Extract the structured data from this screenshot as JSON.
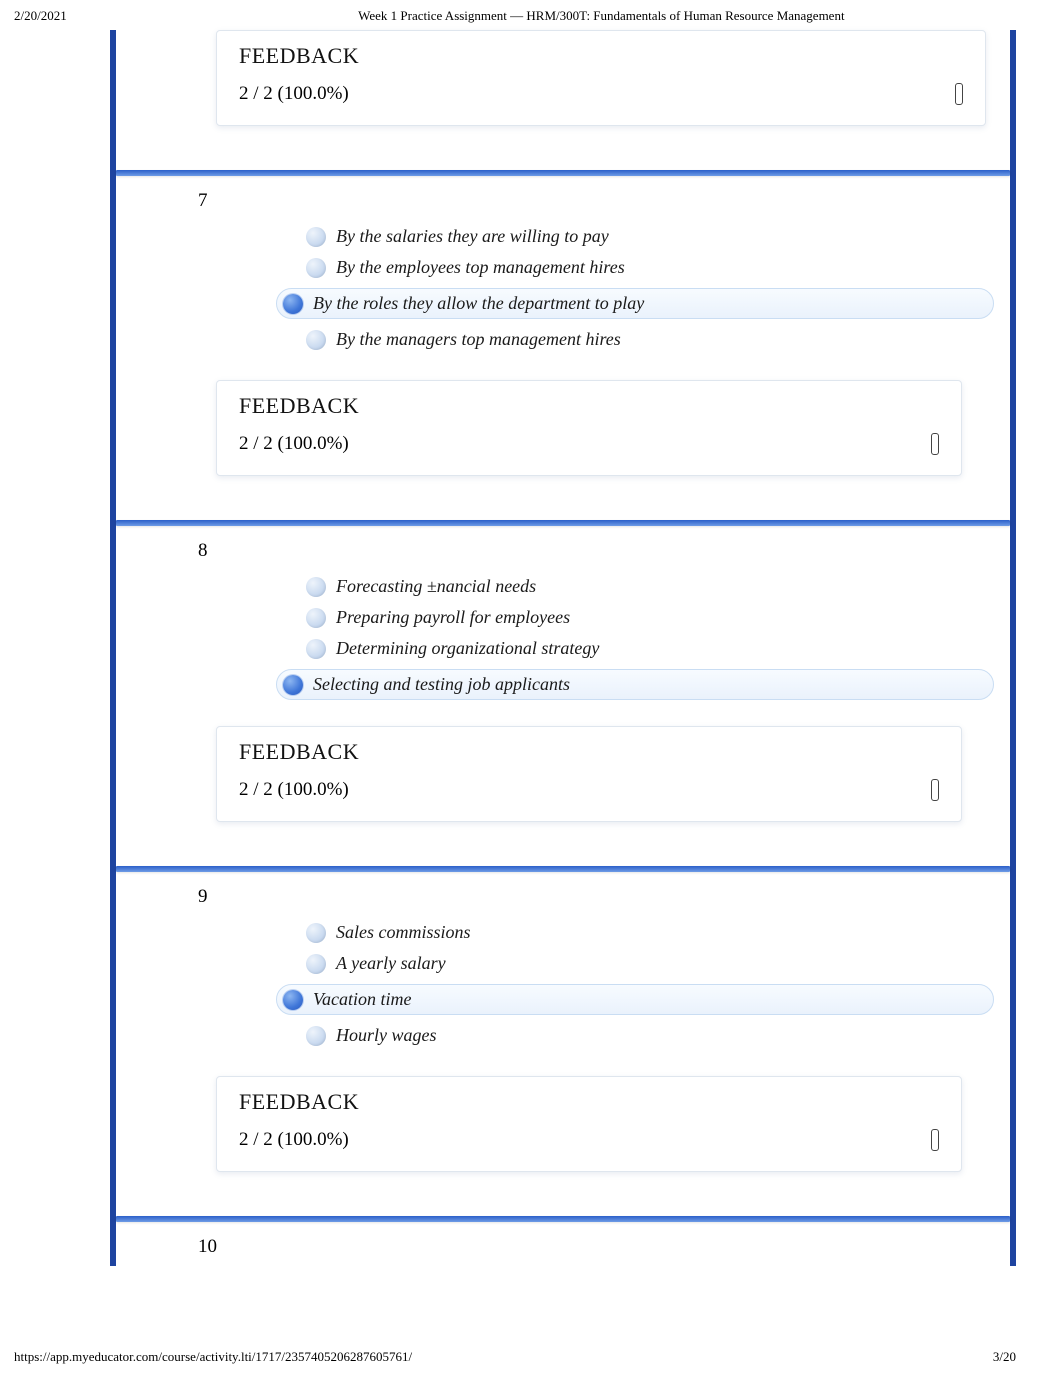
{
  "print_header": {
    "date": "2/20/2021",
    "title": "Week 1 Practice Assignment — HRM/300T: Fundamentals of Human Resource Management"
  },
  "feedback_label": "FEEDBACK",
  "questions": [
    {
      "number": "",
      "options": [],
      "feedback_score": "2 / 2 (100.0%)"
    },
    {
      "number": "7",
      "options": [
        {
          "text": "By the salaries they are willing to pay",
          "selected": false,
          "highlight": false
        },
        {
          "text": "By the employees top management hires",
          "selected": false,
          "highlight": false
        },
        {
          "text": "By the roles they allow the department to play",
          "selected": true,
          "highlight": true
        },
        {
          "text": "By the managers top management hires",
          "selected": false,
          "highlight": false
        }
      ],
      "feedback_score": "2 / 2 (100.0%)"
    },
    {
      "number": "8",
      "options": [
        {
          "text": "Forecasting ±nancial needs",
          "selected": false,
          "highlight": false
        },
        {
          "text": "Preparing payroll for employees",
          "selected": false,
          "highlight": false
        },
        {
          "text": "Determining organizational strategy",
          "selected": false,
          "highlight": false
        },
        {
          "text": "Selecting and testing job applicants",
          "selected": true,
          "highlight": true
        }
      ],
      "feedback_score": "2 / 2 (100.0%)"
    },
    {
      "number": "9",
      "options": [
        {
          "text": "Sales commissions",
          "selected": false,
          "highlight": false
        },
        {
          "text": "A yearly salary",
          "selected": false,
          "highlight": false
        },
        {
          "text": "Vacation time",
          "selected": true,
          "highlight": true
        },
        {
          "text": "Hourly wages",
          "selected": false,
          "highlight": false
        }
      ],
      "feedback_score": "2 / 2 (100.0%)"
    },
    {
      "number": "10",
      "options": [],
      "feedback_score": ""
    }
  ],
  "footer": {
    "url": "https://app.myeducator.com/course/activity.lti/1717/2357405206287605761/",
    "page": "3/20"
  }
}
